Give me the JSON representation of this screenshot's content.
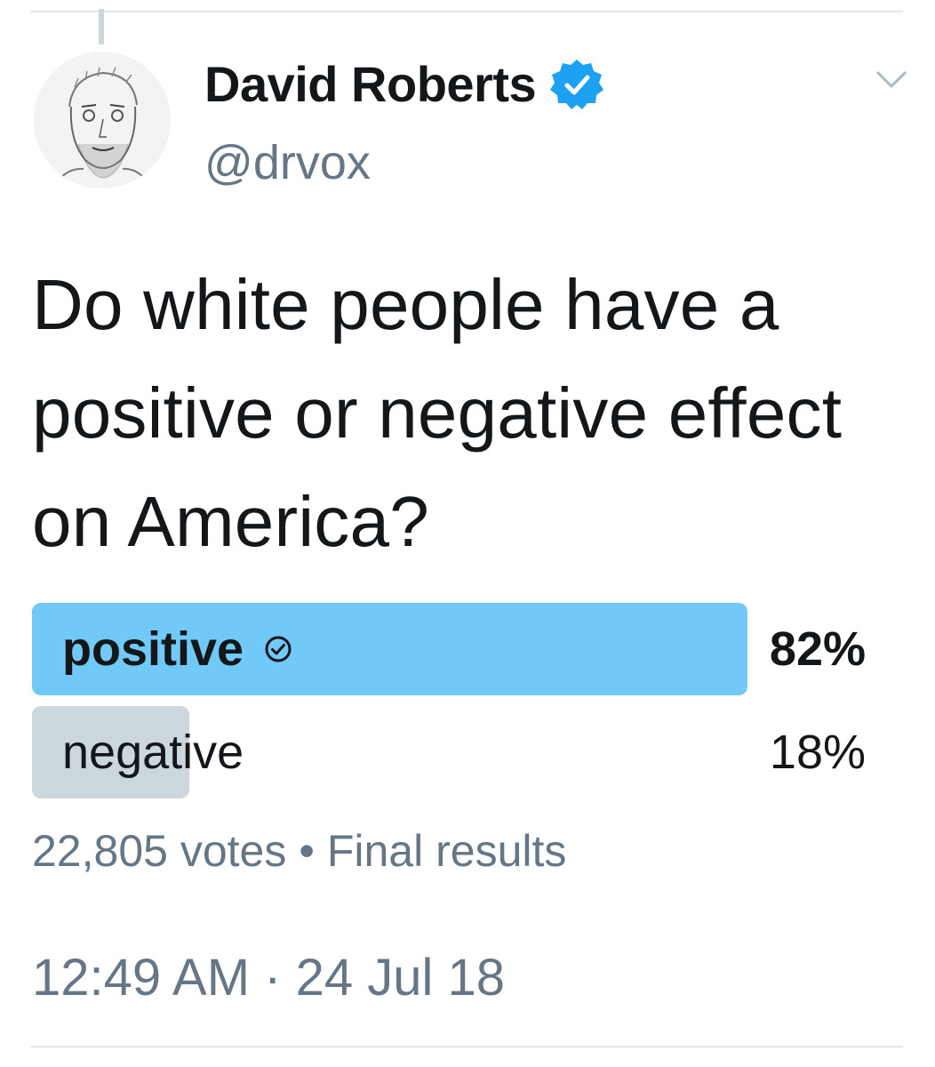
{
  "author": {
    "display_name": "David Roberts",
    "handle": "@drvox",
    "verified": true
  },
  "tweet": {
    "text": "Do white people have a positive or negative effect on America?"
  },
  "poll": {
    "options": [
      {
        "label": "positive",
        "percent_text": "82%",
        "fraction": 0.82,
        "winner": true,
        "bar_color": "#71c9f8"
      },
      {
        "label": "negative",
        "percent_text": "18%",
        "fraction": 0.18,
        "winner": false,
        "bar_color": "#ccd6dd"
      }
    ],
    "votes": "22,805 votes",
    "separator": "•",
    "status": "Final results"
  },
  "timestamp": "12:49 AM · 24 Jul 18",
  "icons": {
    "verified": "verified-badge-icon",
    "menu": "chevron-down-icon",
    "winner": "check-circle-icon"
  },
  "colors": {
    "accent": "#1da1f2",
    "muted_text": "#657786",
    "primary_text": "#14171a"
  }
}
